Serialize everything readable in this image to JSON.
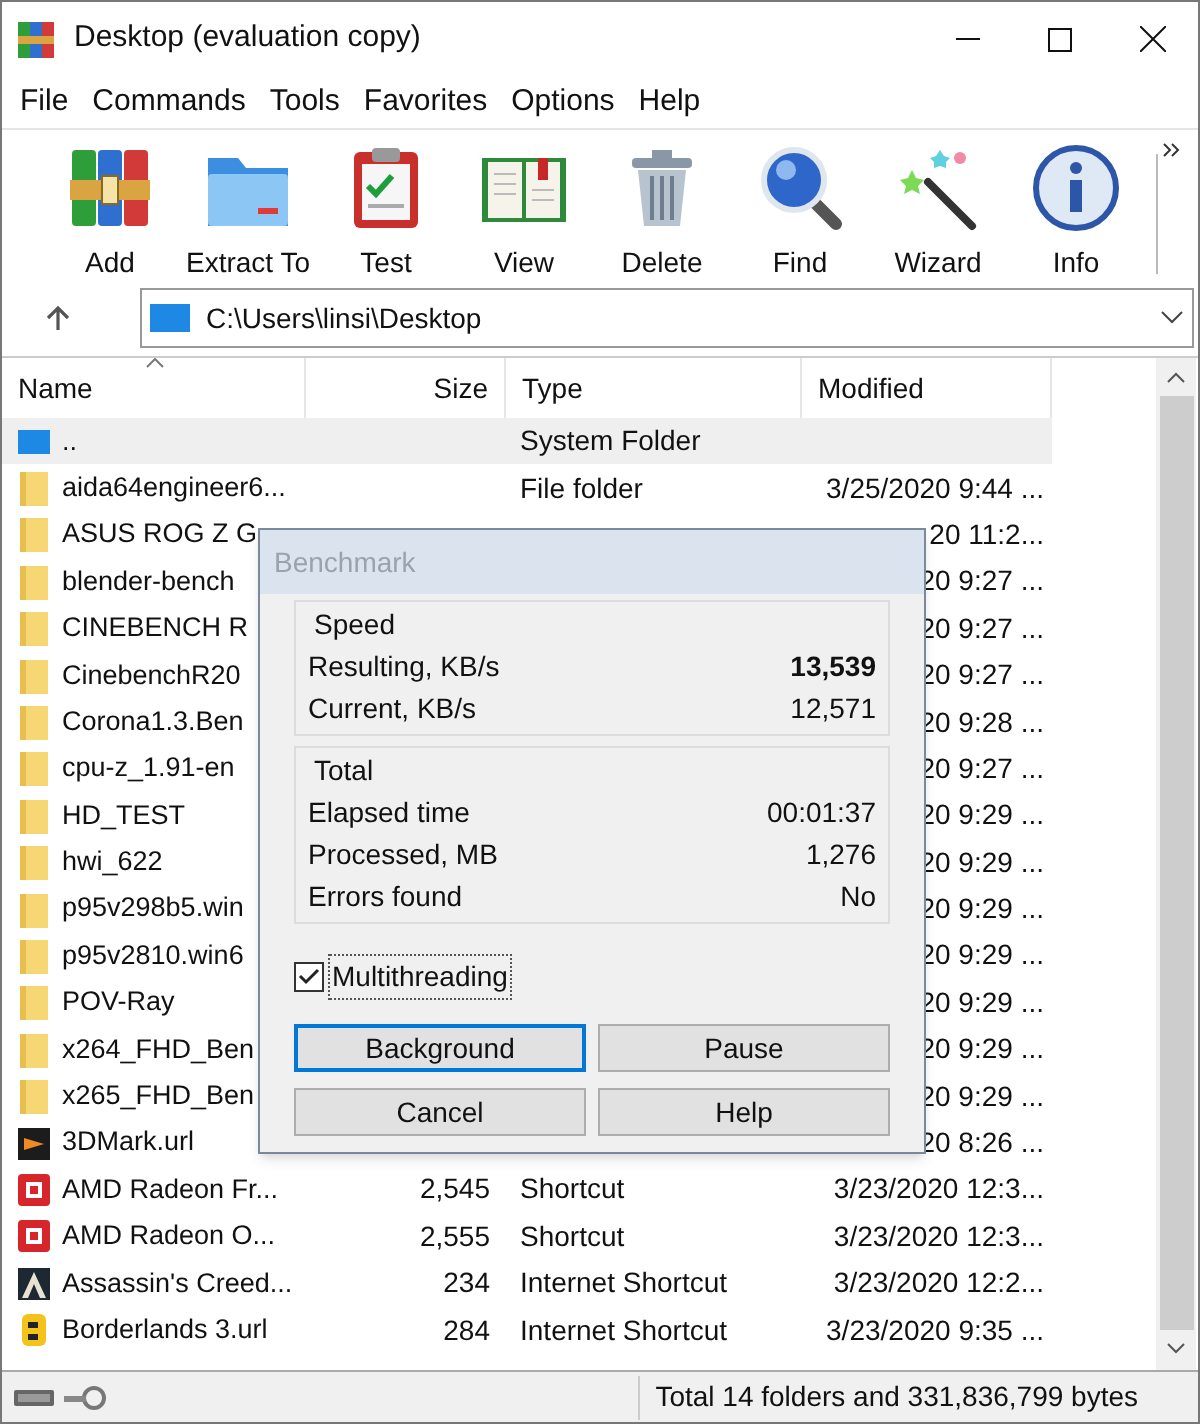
{
  "window": {
    "title": "Desktop (evaluation copy)"
  },
  "menu": [
    "File",
    "Commands",
    "Tools",
    "Favorites",
    "Options",
    "Help"
  ],
  "toolbar": [
    {
      "label": "Add",
      "kind": "add"
    },
    {
      "label": "Extract To",
      "kind": "extract"
    },
    {
      "label": "Test",
      "kind": "test"
    },
    {
      "label": "View",
      "kind": "view"
    },
    {
      "label": "Delete",
      "kind": "delete"
    },
    {
      "label": "Find",
      "kind": "find"
    },
    {
      "label": "Wizard",
      "kind": "wizard"
    },
    {
      "label": "Info",
      "kind": "info"
    }
  ],
  "address": {
    "path": "C:\\Users\\linsi\\Desktop"
  },
  "columns": [
    {
      "label": "Name",
      "sorted": true
    },
    {
      "label": "Size",
      "sorted": false
    },
    {
      "label": "Type",
      "sorted": false
    },
    {
      "label": "Modified",
      "sorted": false
    }
  ],
  "rows": [
    {
      "kind": "parent",
      "name": "..",
      "type": "System Folder",
      "selected": true
    },
    {
      "kind": "folder",
      "name": "aida64engineer6...",
      "type": "File folder",
      "modified": "3/25/2020 9:44 ...",
      "selected": false
    },
    {
      "kind": "folder",
      "name": "ASUS ROG Z G",
      "modified": "20 11:2...",
      "selected": false
    },
    {
      "kind": "folder",
      "name": "blender-bench",
      "modified": "20 9:27 ...",
      "selected": false
    },
    {
      "kind": "folder",
      "name": "CINEBENCH R",
      "modified": "20 9:27 ...",
      "selected": false
    },
    {
      "kind": "folder",
      "name": "CinebenchR20",
      "modified": "20 9:27 ...",
      "selected": false
    },
    {
      "kind": "folder",
      "name": "Corona1.3.Ben",
      "modified": "20 9:28 ...",
      "selected": false
    },
    {
      "kind": "folder",
      "name": "cpu-z_1.91-en",
      "modified": "20 9:27 ...",
      "selected": false
    },
    {
      "kind": "folder",
      "name": "HD_TEST",
      "modified": "20 9:29 ...",
      "selected": false
    },
    {
      "kind": "folder",
      "name": "hwi_622",
      "modified": "20 9:29 ...",
      "selected": false
    },
    {
      "kind": "folder",
      "name": "p95v298b5.win",
      "modified": "20 9:29 ...",
      "selected": false
    },
    {
      "kind": "folder",
      "name": "p95v2810.win6",
      "modified": "20 9:29 ...",
      "selected": false
    },
    {
      "kind": "folder",
      "name": "POV-Ray",
      "modified": "20 9:29 ...",
      "selected": false
    },
    {
      "kind": "folder",
      "name": "x264_FHD_Ben",
      "modified": "20 9:29 ...",
      "selected": false
    },
    {
      "kind": "folder",
      "name": "x265_FHD_Ben",
      "modified": "20 9:29 ...",
      "selected": false
    },
    {
      "kind": "dark",
      "name": "3DMark.url",
      "modified": "20 8:26 ...",
      "selected": false
    },
    {
      "kind": "red",
      "name": "AMD Radeon Fr...",
      "size": "2,545",
      "type": "Shortcut",
      "modified": "3/23/2020 12:3...",
      "selected": false
    },
    {
      "kind": "red",
      "name": "AMD Radeon O...",
      "size": "2,555",
      "type": "Shortcut",
      "modified": "3/23/2020 12:3...",
      "selected": false
    },
    {
      "kind": "peak",
      "name": "Assassin's Creed...",
      "size": "234",
      "type": "Internet Shortcut",
      "modified": "3/23/2020 12:2...",
      "selected": false
    },
    {
      "kind": "yellow",
      "name": "Borderlands 3.url",
      "size": "284",
      "type": "Internet Shortcut",
      "modified": "3/23/2020 9:35 ...",
      "selected": false
    }
  ],
  "status_bar": {
    "text": "Total 14 folders and 331,836,799 bytes"
  },
  "dialog": {
    "title": "Benchmark",
    "groups": [
      {
        "title": "Speed",
        "rows": [
          {
            "label": "Resulting, KB/s",
            "value": "13,539",
            "bold": true
          },
          {
            "label": "Current, KB/s",
            "value": "12,571",
            "bold": false
          }
        ]
      },
      {
        "title": "Total",
        "rows": [
          {
            "label": "Elapsed time",
            "value": "00:01:37",
            "bold": false
          },
          {
            "label": "Processed, MB",
            "value": "1,276",
            "bold": false
          },
          {
            "label": "Errors found",
            "value": "No",
            "bold": false
          }
        ]
      }
    ],
    "multithreading": {
      "label": "Multithreading",
      "checked": true
    },
    "buttons": [
      {
        "label": "Background",
        "default": true
      },
      {
        "label": "Pause",
        "default": false
      },
      {
        "label": "Cancel",
        "default": false
      },
      {
        "label": "Help",
        "default": false
      }
    ]
  }
}
